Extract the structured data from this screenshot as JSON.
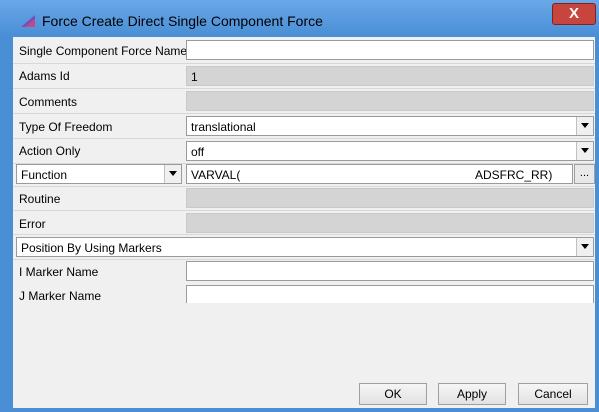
{
  "window": {
    "title": "Force Create Direct Single Component Force",
    "close_label": "X"
  },
  "fields": {
    "name_label": "Single Component Force Name",
    "name_value": "",
    "adams_id_label": "Adams Id",
    "adams_id_value": "1",
    "comments_label": "Comments",
    "comments_value": "",
    "type_of_freedom_label": "Type Of Freedom",
    "type_of_freedom_value": "translational",
    "action_only_label": "Action Only",
    "action_only_value": "off",
    "function_selector_value": "Function",
    "function_value_left": "VARVAL(",
    "function_value_right": "ADSFRC_RR)",
    "function_browse_label": "...",
    "routine_label": "Routine",
    "routine_value": "",
    "error_label": "Error",
    "error_value": "",
    "position_method_value": "Position By Using Markers",
    "i_marker_label": "I Marker Name",
    "i_marker_value": "",
    "j_marker_label": "J Marker Name",
    "j_marker_value": ""
  },
  "buttons": {
    "ok": "OK",
    "apply": "Apply",
    "cancel": "Cancel"
  },
  "colors": {
    "title_bar": "#4a8fd6",
    "close_button": "#c7453c",
    "readonly_field": "#d4d4d4",
    "dialog_bg": "#f0f0f0"
  }
}
